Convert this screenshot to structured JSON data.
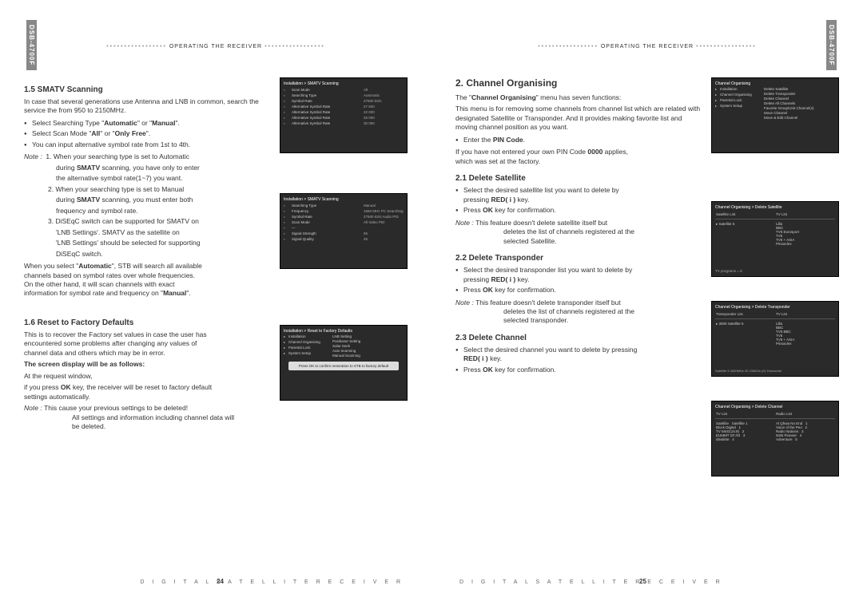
{
  "model": "DSB-4700F",
  "header_text": "OPERATING THE RECEIVER",
  "footer_text": "D I G I T A L   S A T E L L I T E   R E C E I V E R",
  "page_left_num": "24",
  "page_right_num": "25",
  "left": {
    "s15_title": "1.5 SMATV Scanning",
    "s15_p1": "In case that several generations use Antenna and LNB in common, search the service the from 950 to 2150MHz.",
    "s15_b1_pre": "Select Searching Type \"",
    "s15_b1_b1": "Automatic",
    "s15_b1_mid": "\" or \"",
    "s15_b1_b2": "Manual",
    "s15_b1_post": "\".",
    "s15_b2_pre": "Select Scan Mode \"",
    "s15_b2_b1": "All",
    "s15_b2_mid": "\" or \"",
    "s15_b2_b2": "Only Free",
    "s15_b2_post": "\".",
    "s15_b3": "You can input alternative symbol rate from 1st to 4th.",
    "note_label": "Note :",
    "s15_n1a": "1. When your searching type is set to Automatic",
    "s15_n1b_pre": "during ",
    "s15_n1b_b": "SMATV",
    "s15_n1b_post": " scanning, you have only to enter",
    "s15_n1c": "the alternative symbol rate(1~7) you want.",
    "s15_n2a": "2. When your searching type is set to Manual",
    "s15_n2b_pre": "during ",
    "s15_n2b_b": "SMATV",
    "s15_n2b_post": " scanning, you must enter both",
    "s15_n2c": "frequency and symbol rate.",
    "s15_n3a": "3. DiSEqC switch can be supported for SMATV on",
    "s15_n3b": "'LNB Settings'. SMATV as the satellite on",
    "s15_n3c": "'LNB Settings' should be selected for supporting",
    "s15_n3d": "DiSEqC switch.",
    "s15_p2a": "When you select \"",
    "s15_p2a_b": "Automatic",
    "s15_p2a2": "\", STB will search all available",
    "s15_p2b": "channels based on symbol rates over whole frequencies.",
    "s15_p2c": "On the other hand, it will scan channels with exact",
    "s15_p2d_pre": "information for symbol rate and frequency on \"",
    "s15_p2d_b": "Manual",
    "s15_p2d_post": "\".",
    "s16_title": "1.6 Reset to Factory Defaults",
    "s16_p1a": "This is to recover the Factory set values in case the user has",
    "s16_p1b": "encountered some problems after changing any values of",
    "s16_p1c": "channel data and others which may be in error.",
    "s16_bold": "The screen display will be as follows:",
    "s16_p2": "At the request window,",
    "s16_p3a_pre": "if you press ",
    "s16_p3a_b": "OK",
    "s16_p3a_post": " key, the receiver will be reset to factory default",
    "s16_p3b": "settings automatically.",
    "s16_n1": "This cause your previous settings to be deleted!",
    "s16_n2": "All settings and information including channel data will",
    "s16_n3": "be deleted."
  },
  "right": {
    "s2_title": "2. Channel Organising",
    "s2_p1_pre": "The \"",
    "s2_p1_b": "Channel Organising",
    "s2_p1_post": "\" menu has seven functions:",
    "s2_p2": "This menu is for removing some channels from channel list which are related with designated Satellite or Transponder. And it provides making favorite list and moving channel position as you want.",
    "s2_b1_pre": "Enter the ",
    "s2_b1_b": "PIN Code",
    "s2_b1_post": ".",
    "s2_p3_pre": "If you have not entered your own PIN Code ",
    "s2_p3_b": "0000",
    "s2_p3_post": " applies,",
    "s2_p3b": "which was set at the factory.",
    "s21_title": "2.1 Delete Satellite",
    "s21_b1a": "Select the desired satellite list you want to delete by",
    "s21_b1b_pre": "pressing ",
    "s21_b1b_b": "RED( i )",
    "s21_b1b_post": " key.",
    "s21_b2_pre": "Press ",
    "s21_b2_b": "OK",
    "s21_b2_post": " key for confirmation.",
    "s21_n1": "This feature doesn't delete satellite itself but",
    "s21_n2": "deletes the list of channels registered at the",
    "s21_n3": "selected Satellite.",
    "s22_title": "2.2 Delete Transponder",
    "s22_b1a": "Select the desired transponder list you want to delete by",
    "s22_b1b_pre": "pressing ",
    "s22_b1b_b": "RED( i )",
    "s22_b1b_post": " key.",
    "s22_b2_pre": "Press ",
    "s22_b2_b": "OK",
    "s22_b2_post": " key for confirmation.",
    "s22_n1": "This feature doesn't delete transponder itself but",
    "s22_n2": "deletes the list of channels registered at the",
    "s22_n3": "selected transponder.",
    "s23_title": "2.3 Delete Channel",
    "s23_b1a": "Select the desired channel you want to delete by pressing",
    "s23_b1b_b": "RED( i )",
    "s23_b1b_post": " key.",
    "s23_b2_pre": "Press ",
    "s23_b2_b": "OK",
    "s23_b2_post": " key for confirmation."
  },
  "screenshots": {
    "sc1": {
      "title": "Installation > SMATV Scanning",
      "rows": [
        [
          "Scan Mode",
          "All"
        ],
        [
          "Searching Type",
          "Automatic"
        ],
        [
          "Symbol Rate",
          "27500 kS/s"
        ],
        [
          "Alternative Symbol Rate",
          "27 500"
        ],
        [
          "Alternative Symbol Rate",
          "22 000"
        ],
        [
          "Alternative Symbol Rate",
          "26 000"
        ],
        [
          "Alternative Symbol Rate",
          "30 000"
        ]
      ]
    },
    "sc2": {
      "title": "Installation > SMATV Scanning",
      "left": [
        "Searching Type",
        "Frequency",
        "Symbol Rate",
        "Scan Mode",
        "—",
        "Signal Strength",
        "Signal Quality"
      ],
      "right": [
        "Manual",
        "1660 MHz PC Searching",
        "27500 kS/s Audio PID",
        "All  Video PID",
        "",
        "55",
        "45"
      ]
    },
    "sc3": {
      "title": "Installation > Reset to Factory Defaults",
      "menu": [
        "Installation",
        "Channel Organising",
        "Parental Lock",
        "System Setup"
      ],
      "list": [
        "LNB Setting",
        "Positioner Setting",
        "Solar Seek",
        "Auto Scanning",
        "Manual Scanning"
      ],
      "dialog": "Press OK to confirm restoration to STB to factory default"
    },
    "sc4": {
      "title": "Channel Organising",
      "menu": [
        "Installation",
        "Channel Organising",
        "Parental Lock",
        "System Setup"
      ],
      "list": [
        "Delete Satellite",
        "Delete Transponder",
        "Delete Channel",
        "Delete All Channels",
        "Favorite Group/Unit Channel(s)",
        "Move Channel",
        "Move & Edit Channel"
      ]
    },
    "sc5": {
      "title": "Channel Organising > Delete Satellite",
      "cols": [
        "Satellite List",
        "TV List"
      ],
      "left": [
        "Satellite 5"
      ],
      "right": [
        "Lilla",
        "BBC",
        "TV5  Eurosport",
        "TV5",
        "TV5 + ASIA",
        "Pinnacles"
      ],
      "info": "TV programs = 6"
    },
    "sc6": {
      "title": "Channel Organising > Delete Transponder",
      "cols": [
        "Transponder List",
        "TV List"
      ],
      "left": [
        "3000 Satellite 5"
      ],
      "right": [
        "Lilla",
        "BBC",
        "TV5  BBC",
        "TV5",
        "TV5 + ASIA",
        "Pinnacles"
      ],
      "info": "Satellite 5   4000MHz  20 233kS/s  (H) Horizontal"
    },
    "sc7": {
      "title": "Channel Organising > Delete Channel",
      "cols": [
        "TV List",
        "Radio List"
      ],
      "left_rows": [
        [
          "Satellite",
          "Satellite 1"
        ],
        [
          "Block Digital",
          "1"
        ],
        [
          "TV MSG(15:9)",
          "2"
        ],
        [
          "EUMMT GF./St",
          "3"
        ],
        [
          "idealiste",
          "4"
        ]
      ],
      "right_rows": [
        [
          "Al Qhwa No End",
          "1"
        ],
        [
          "Voice of the Peo",
          "2"
        ],
        [
          "Radio Nations",
          "3"
        ],
        [
          "NSB Pioneer",
          "4"
        ],
        [
          "Adventure",
          "5"
        ]
      ]
    }
  }
}
